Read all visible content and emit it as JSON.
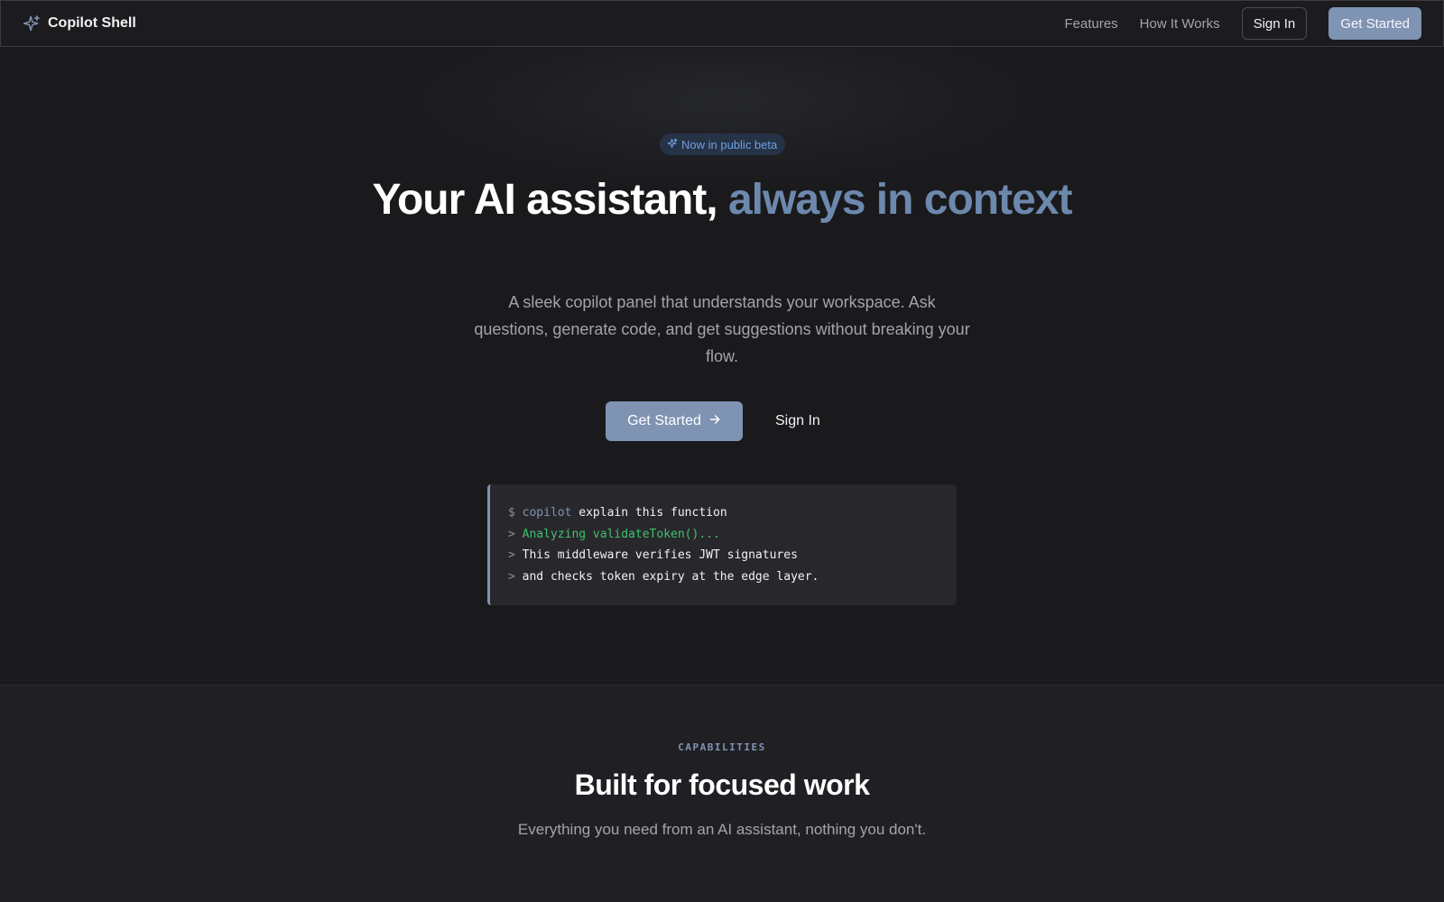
{
  "nav": {
    "brand_icon": "sparkle-icon",
    "brand_name": "Copilot Shell",
    "links": [
      {
        "label": "Features"
      },
      {
        "label": "How It Works"
      }
    ],
    "sign_in_label": "Sign In",
    "get_started_label": "Get Started"
  },
  "hero": {
    "badge_icon": "sparkle-icon",
    "badge_label": "Now in public beta",
    "headline_main": "Your AI assistant,",
    "headline_accent": "always in context",
    "subheadline": "A sleek copilot panel that understands your workspace. Ask questions, generate code, and get suggestions without breaking your flow.",
    "cta_primary_label": "Get Started",
    "cta_primary_icon": "arrow-right-icon",
    "cta_secondary_label": "Sign In",
    "terminal": {
      "lines": [
        {
          "prompt": "$",
          "cmd": "copilot",
          "text": " explain this function"
        },
        {
          "prompt": ">",
          "ok": "Analyzing validateToken()..."
        },
        {
          "prompt": ">",
          "text": "This middleware verifies JWT signatures"
        },
        {
          "prompt": ">",
          "text": "and checks token expiry at the edge layer."
        }
      ]
    }
  },
  "capabilities": {
    "eyebrow": "CAPABILITIES",
    "title": "Built for focused work",
    "subtitle": "Everything you need from an AI assistant, nothing you don't."
  },
  "colors": {
    "background": "#1a1a1d",
    "accent": "#7f93b2",
    "accent_text": "#6d88ad",
    "success": "#3fc16e",
    "badge_bg": "#263246",
    "badge_text": "#6fa0e0"
  }
}
